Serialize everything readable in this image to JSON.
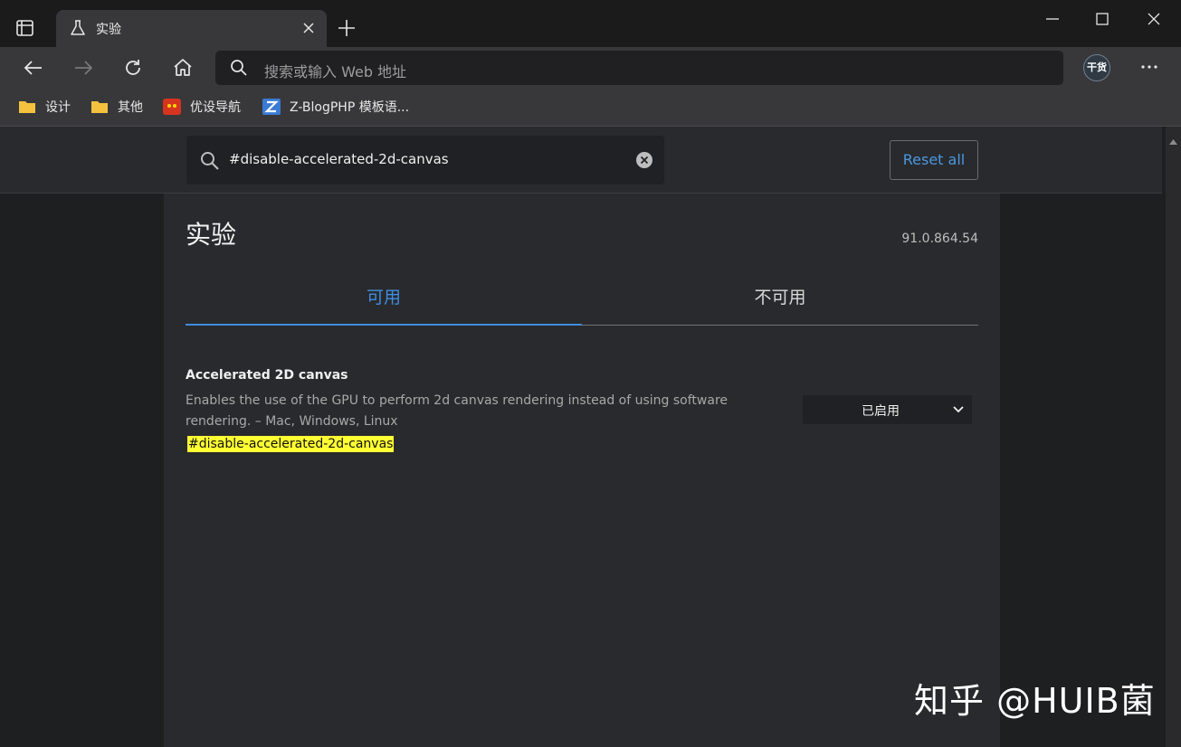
{
  "browser": {
    "tab_title": "实验",
    "address_placeholder": "搜索或输入 Web 地址",
    "profile_label": "干货",
    "bookmarks": [
      "设计",
      "其他",
      "优设导航",
      "Z-BlogPHP 模板语..."
    ]
  },
  "flags_page": {
    "search_value": "#disable-accelerated-2d-canvas",
    "reset_label": "Reset all",
    "title": "实验",
    "version": "91.0.864.54",
    "tabs": [
      {
        "label": "可用",
        "active": true
      },
      {
        "label": "不可用",
        "active": false
      }
    ],
    "flag": {
      "name": "Accelerated 2D canvas",
      "description": "Enables the use of the GPU to perform 2d canvas rendering instead of using software rendering. – Mac, Windows, Linux",
      "link": "#disable-accelerated-2d-canvas",
      "selected_value": "已启用"
    }
  },
  "watermark": "知乎 @HUIB菌",
  "colors": {
    "accent": "#3e8ede",
    "highlight": "#ffff33",
    "panel": "#292a2d",
    "background": "#1e1f21"
  },
  "icons": [
    "tab-actions-icon",
    "flask-icon",
    "close-icon",
    "plus-icon",
    "minimize-icon",
    "maximize-icon",
    "window-close-icon",
    "back-icon",
    "forward-icon",
    "refresh-icon",
    "home-icon",
    "search-icon",
    "more-icon",
    "folder-icon",
    "clear-icon",
    "chevron-down-icon"
  ]
}
